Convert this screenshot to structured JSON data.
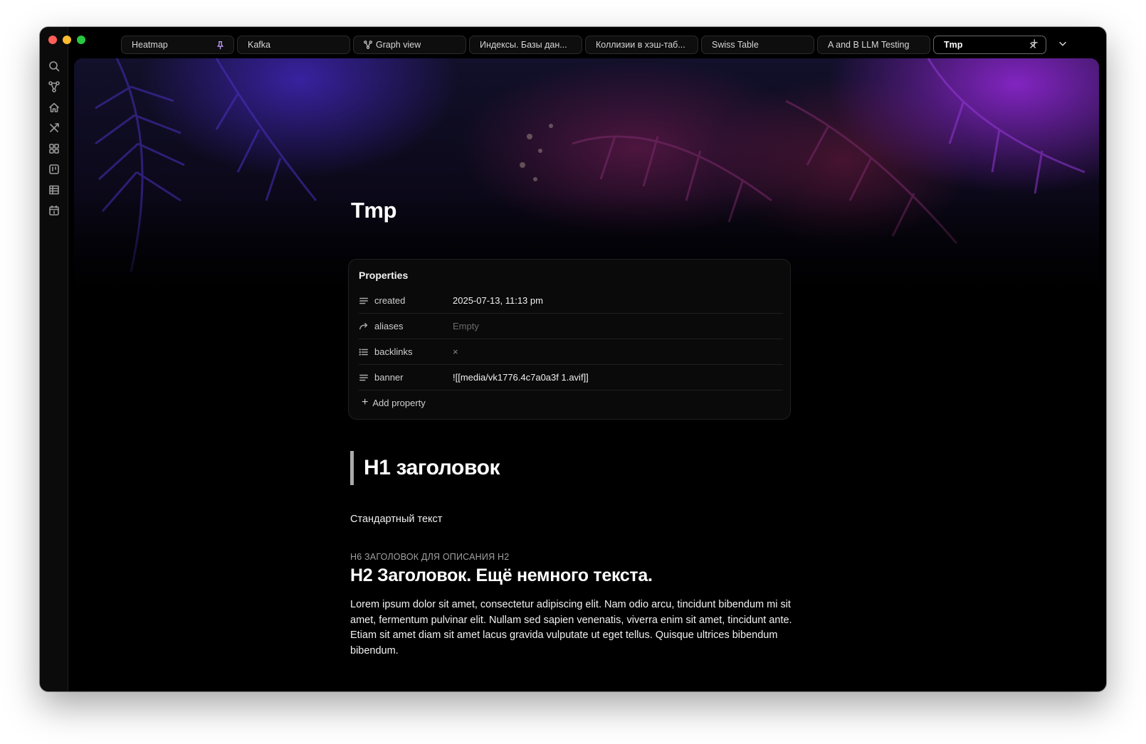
{
  "window": {
    "traffic_lights": [
      "close",
      "minimize",
      "zoom"
    ]
  },
  "ribbon": {
    "icons": [
      "search-icon",
      "graph-icon",
      "home-icon",
      "tools-icon",
      "grid-icon",
      "kanban-icon",
      "table-icon",
      "calendar-icon"
    ]
  },
  "tabs": [
    {
      "label": "Heatmap",
      "pinned": true,
      "icon": ""
    },
    {
      "label": "Kafka",
      "pinned": false,
      "icon": ""
    },
    {
      "label": "Graph view",
      "pinned": false,
      "icon": "graph-icon"
    },
    {
      "label": "Индексы. Базы дан...",
      "pinned": false,
      "icon": ""
    },
    {
      "label": "Коллизии в хэш-таб...",
      "pinned": false,
      "icon": ""
    },
    {
      "label": "Swiss Table",
      "pinned": false,
      "icon": ""
    },
    {
      "label": "A and B LLM Testing",
      "pinned": false,
      "icon": ""
    },
    {
      "label": "Tmp",
      "active": true,
      "icon": ""
    }
  ],
  "tabbar": {
    "new_tab": "+",
    "close_glyph": "✕"
  },
  "note": {
    "title": "Tmp",
    "properties": {
      "heading": "Properties",
      "rows": [
        {
          "key": "created",
          "value": "2025-07-13, 11:13 pm",
          "icon": "text-lines-icon"
        },
        {
          "key": "aliases",
          "value": "Empty",
          "icon": "alias-arrow-icon"
        },
        {
          "key": "backlinks",
          "value": "×",
          "icon": "list-icon"
        },
        {
          "key": "banner",
          "value": "![[media/vk1776.4c7a0a3f 1.avif]]",
          "icon": "text-lines-icon"
        }
      ],
      "add_label": "Add property"
    },
    "h1": "H1 заголовок",
    "paragraph": "Стандартный текст",
    "h6": "H6 ЗАГОЛОВОК ДЛЯ ОПИСАНИЯ H2",
    "h2": "H2 Заголовок. Ещё немного текста.",
    "lorem": "Lorem ipsum dolor sit amet, consectetur adipiscing elit. Nam odio arcu, tincidunt bibendum mi sit amet, fermentum pulvinar elit. Nullam sed sapien venenatis, viverra enim sit amet, tincidunt ante. Etiam sit amet diam sit amet lacus gravida vulputate ut eget tellus. Quisque ultrices bibendum bibendum."
  },
  "colors": {
    "pin": "#c8a0ff",
    "background": "#000000",
    "banner_purple": "#9628dc"
  }
}
